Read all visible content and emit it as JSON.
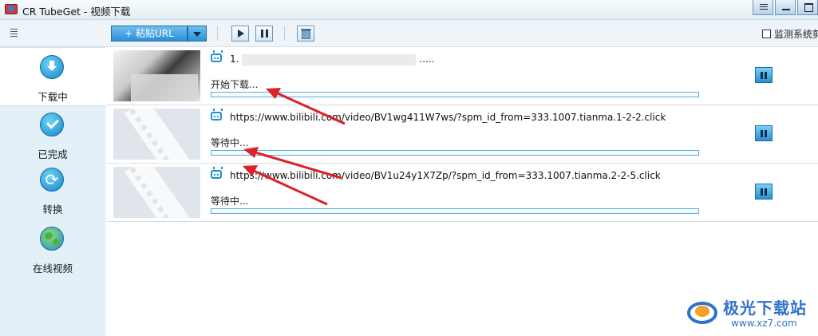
{
  "window": {
    "title": "CR TubeGet - 视频下载",
    "controls": [
      "menu-icon",
      "minimize-icon",
      "maximize-icon"
    ]
  },
  "toolbar": {
    "paste_label": "+ 粘贴URL",
    "monitor_label": "监测系统剪",
    "monitor_checked": false
  },
  "sidebar": {
    "items": [
      {
        "label": "下载中",
        "icon": "download-icon",
        "active": true
      },
      {
        "label": "已完成",
        "icon": "check-icon",
        "active": false
      },
      {
        "label": "转换",
        "icon": "convert-icon",
        "active": false
      },
      {
        "label": "在线视频",
        "icon": "globe-icon",
        "active": false
      }
    ]
  },
  "downloads": [
    {
      "index_label": "1.",
      "title_suffix": ".....",
      "status": "开始下载...",
      "progress": 0
    },
    {
      "url": "https://www.bilibili.com/video/BV1wg411W7ws/?spm_id_from=333.1007.tianma.1-2-2.click",
      "status": "等待中...",
      "progress": 0
    },
    {
      "url": "https://www.bilibili.com/video/BV1u24y1X7Zp/?spm_id_from=333.1007.tianma.2-2-5.click",
      "status": "等待中...",
      "progress": 0
    }
  ],
  "colors": {
    "accent": "#2a9ee0",
    "arrow": "#d8232a",
    "watermark": "#2f73c9"
  },
  "watermark": {
    "name": "极光下载站",
    "url": "www.xz7.com"
  }
}
